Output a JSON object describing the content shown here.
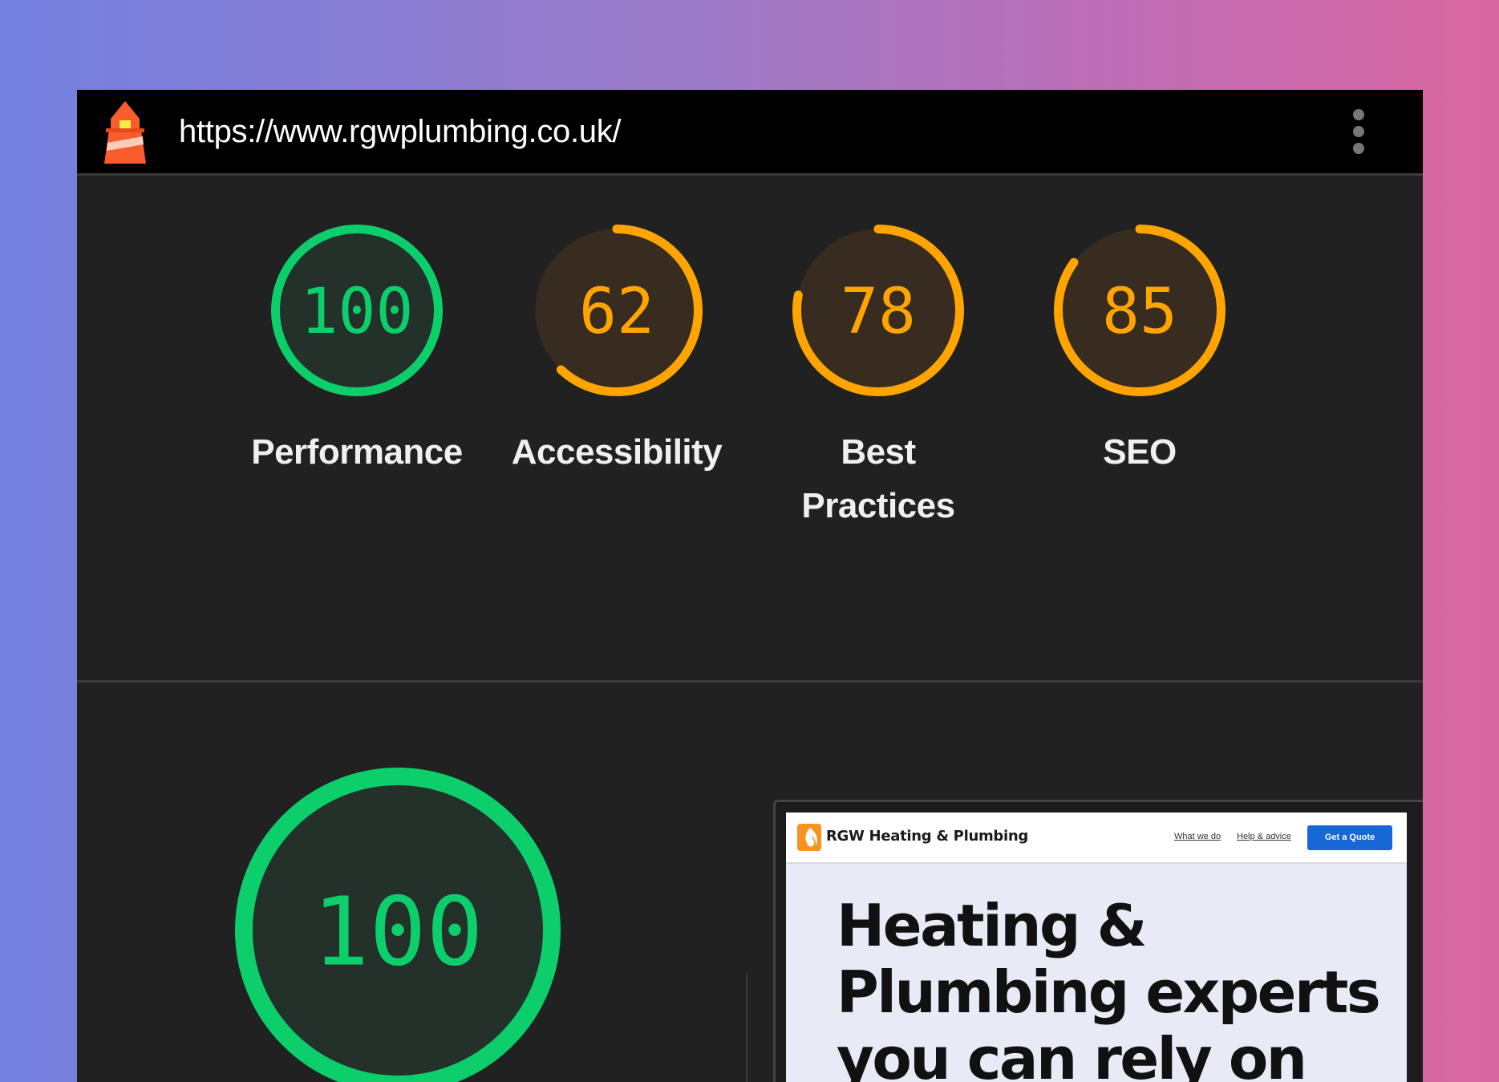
{
  "header": {
    "url": "https://www.rgwplumbing.co.uk/",
    "logo_icon": "lighthouse-icon",
    "menu_icon": "kebab-menu-icon"
  },
  "categories": [
    {
      "label": "Performance",
      "score": 100,
      "status": "pass"
    },
    {
      "label": "Accessibility",
      "score": 62,
      "status": "average"
    },
    {
      "label": "Best Practices",
      "score": 78,
      "status": "average"
    },
    {
      "label": "SEO",
      "score": 85,
      "status": "average"
    }
  ],
  "summary": {
    "score": 100,
    "status": "pass"
  },
  "screenshot": {
    "brand": "RGW Heating & Plumbing",
    "nav_links": [
      "What we do",
      "Help & advice"
    ],
    "cta": "Get a Quote",
    "hero_lines": [
      "Heating &",
      "Plumbing experts",
      "you can rely on"
    ]
  },
  "colors": {
    "pass": "#0cce6b",
    "pass_bg": "#24302a",
    "average": "#ffa400",
    "average_bg": "#382c21",
    "background": "#212121",
    "topbar": "#000000",
    "gradient_start": "#7480e0",
    "gradient_end": "#d9679f"
  }
}
